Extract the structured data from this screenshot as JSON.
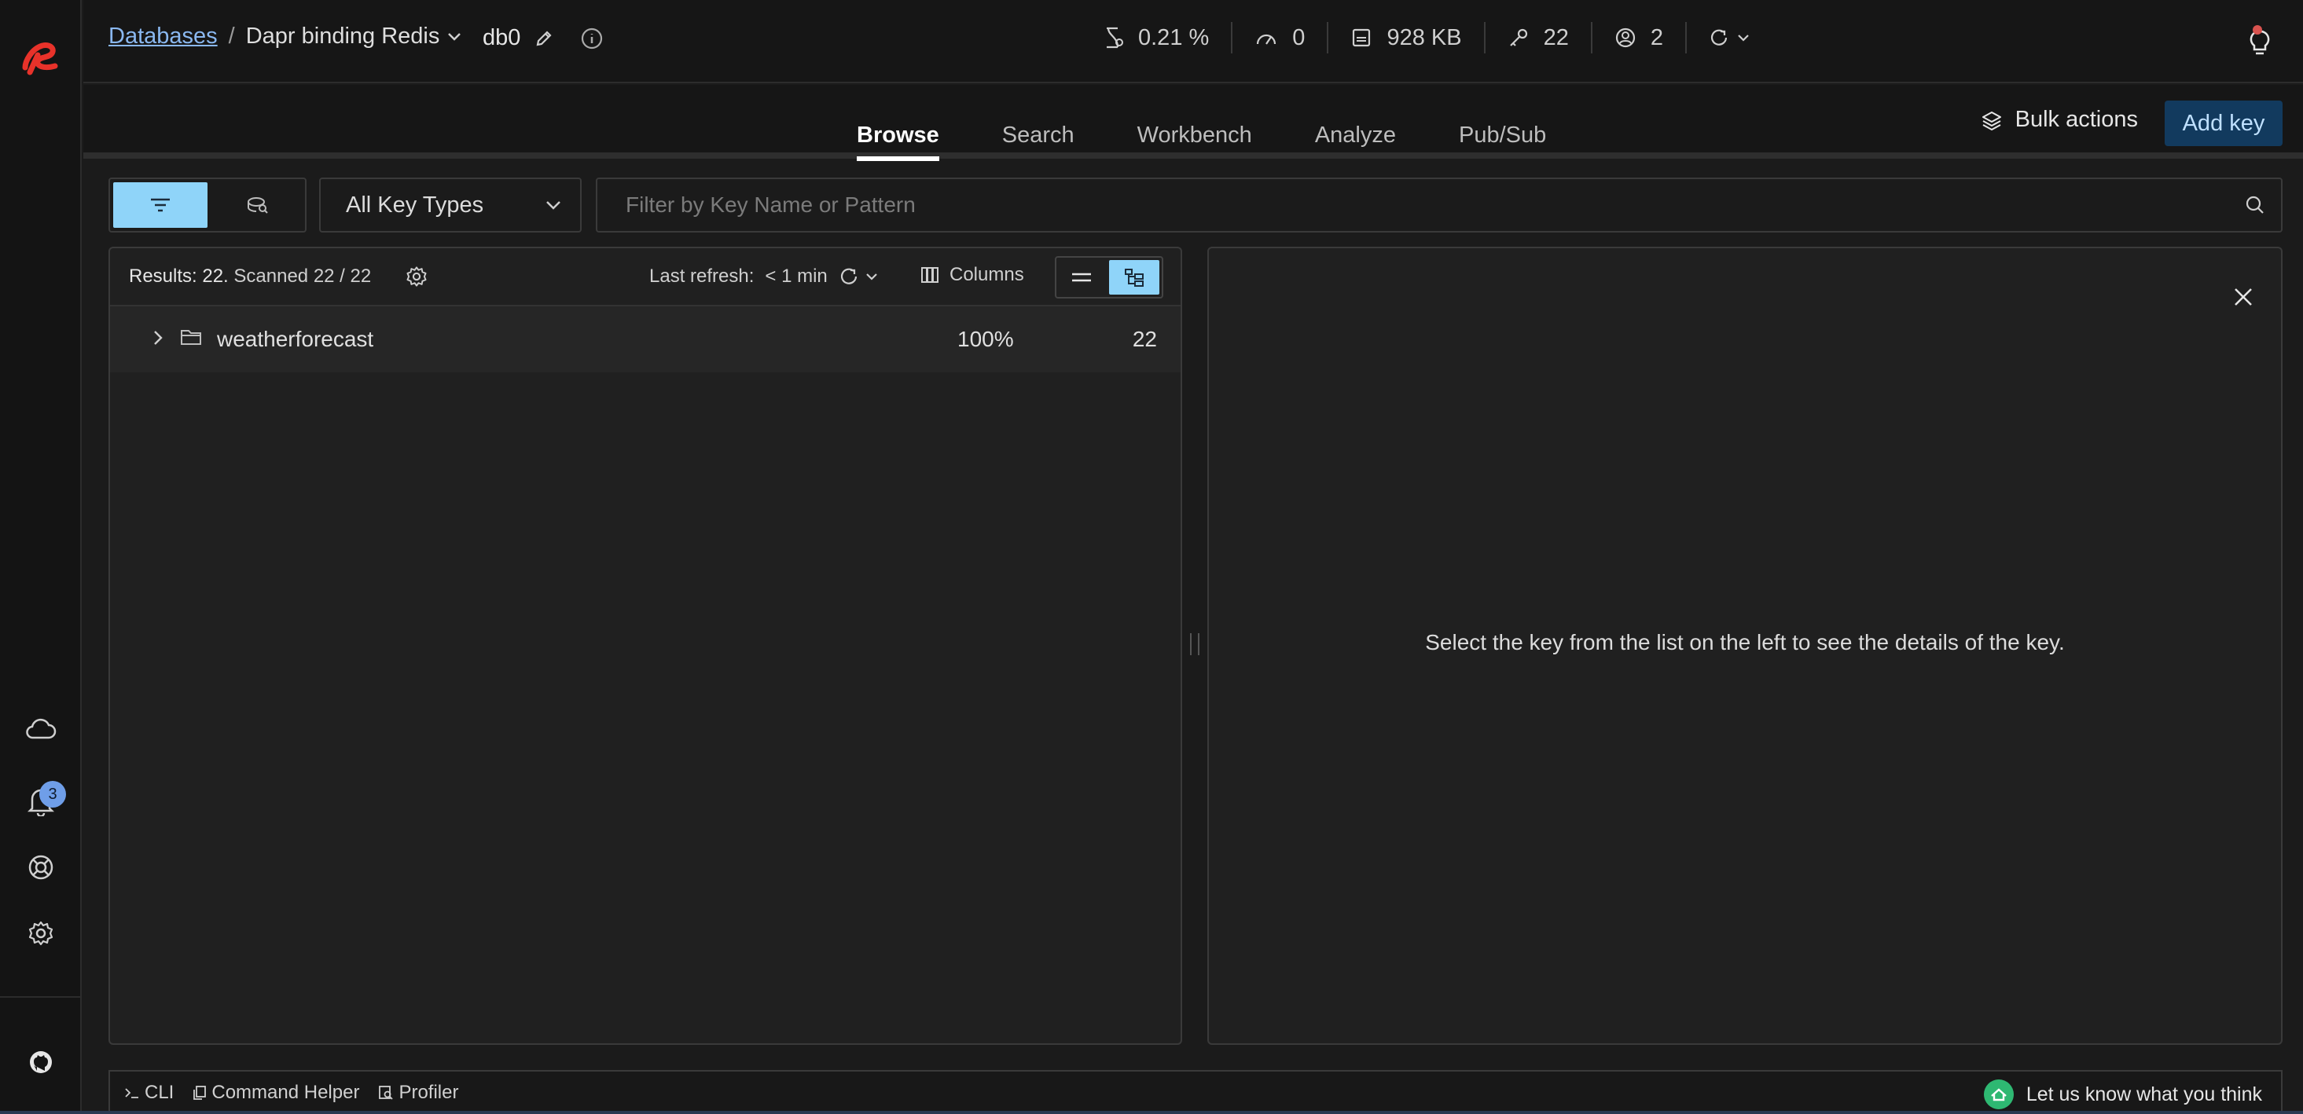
{
  "icons": {
    "logo": "redis-logo-icon",
    "cloud": "cloud-icon",
    "notifications": "bell-icon",
    "help": "lifebuoy-icon",
    "settings": "gear-icon",
    "github": "github-icon"
  },
  "colors": {
    "accent": "#8fd4f9",
    "link": "#8ab8f0",
    "logo": "#e8322a",
    "add_key_bg": "#123a5e",
    "badge": "#6f9ee8"
  },
  "rail": {
    "notification_count": "3"
  },
  "header": {
    "breadcrumb_root": "Databases",
    "breadcrumb_sep": "/",
    "database": "Dapr binding Redis",
    "db_index": "db0",
    "stats": {
      "cpu": "0.21 %",
      "ops": "0",
      "memory": "928 KB",
      "keys": "22",
      "clients": "2"
    }
  },
  "tabs": [
    "Browse",
    "Search",
    "Workbench",
    "Analyze",
    "Pub/Sub"
  ],
  "active_tab": "Browse",
  "actions": {
    "bulk": "Bulk actions",
    "add_key": "Add key"
  },
  "filters": {
    "key_type": "All Key Types",
    "search_placeholder": "Filter by Key Name or Pattern",
    "search_value": ""
  },
  "list": {
    "results": "Results: 22.",
    "scanned": "Scanned 22 / 22",
    "last_refresh_label": "Last refresh:",
    "last_refresh_value": "< 1 min",
    "columns_label": "Columns",
    "rows": [
      {
        "name": "weatherforecast",
        "percent": "100%",
        "count": "22"
      }
    ]
  },
  "details": {
    "empty_message": "Select the key from the list on the left to see the details of the key."
  },
  "bottom": {
    "cli": "CLI",
    "command_helper": "Command Helper",
    "profiler": "Profiler",
    "feedback": "Let us know what you think"
  }
}
